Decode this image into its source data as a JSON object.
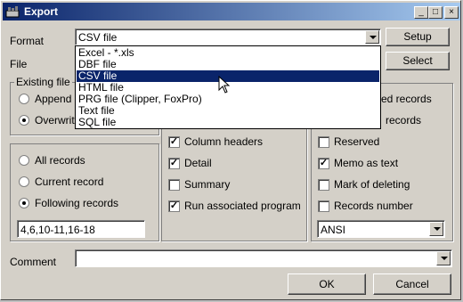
{
  "window": {
    "title": "Export"
  },
  "titlebar": {
    "min": "_",
    "max": "□",
    "close": "×"
  },
  "format": {
    "label": "Format",
    "value": "CSV file",
    "setup_label": "Setup",
    "options": [
      "Excel - *.xls",
      "DBF file",
      "CSV file",
      "HTML file",
      "PRG file (Clipper, FoxPro)",
      "Text file",
      "SQL file"
    ],
    "selected_index": 2
  },
  "file": {
    "label": "File",
    "select_label": "Select"
  },
  "existing_file": {
    "title": "Existing file",
    "append": "Append",
    "overwrite": "Overwrite",
    "selected": "overwrite"
  },
  "records": {
    "all": "All records",
    "current": "Current record",
    "following": "Following records",
    "selected": "following",
    "range_value": "4,6,10-11,16-18"
  },
  "middle": {
    "column_headers": "Column headers",
    "column_headers_checked": true,
    "detail": "Detail",
    "detail_checked": true,
    "summary": "Summary",
    "summary_checked": false,
    "run_program": "Run associated program",
    "run_program_checked": true
  },
  "right": {
    "partial1": "ed records",
    "partial2": "records",
    "reserved": "Reserved",
    "reserved_checked": false,
    "memo": "Memo as text",
    "memo_checked": true,
    "mark_deleting": "Mark of deleting",
    "mark_deleting_checked": false,
    "records_number": "Records number",
    "records_number_checked": false,
    "encoding": "ANSI"
  },
  "comment": {
    "label": "Comment",
    "value": ""
  },
  "buttons": {
    "ok": "OK",
    "cancel": "Cancel"
  },
  "colors": {
    "titlebar_start": "#0a246a",
    "titlebar_end": "#a6caf0",
    "selection": "#0a246a",
    "face": "#d4d0c8"
  }
}
